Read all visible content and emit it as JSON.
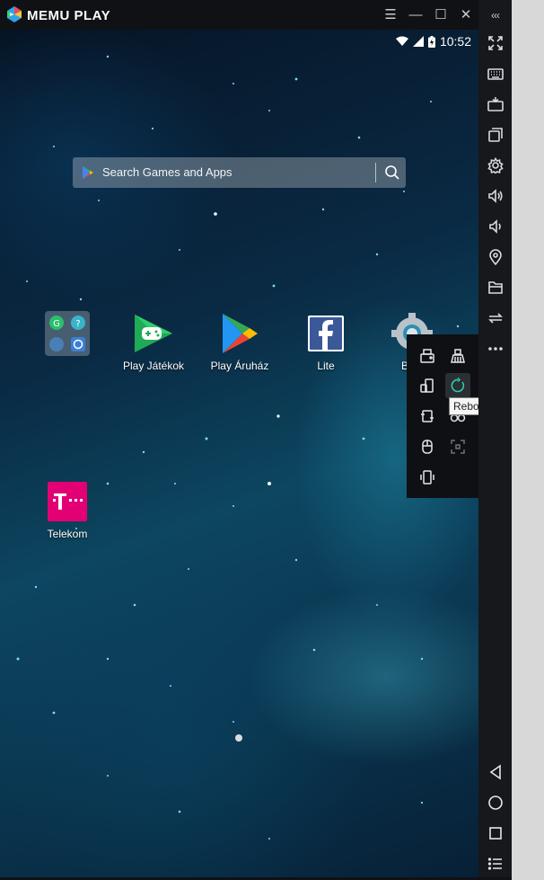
{
  "window": {
    "brand": "MEMU PLAY",
    "menu_icon": "hamburger-icon",
    "minimize_icon": "minimize-icon",
    "maximize_icon": "maximize-icon",
    "close_icon": "close-icon",
    "collapse_label": "‹‹‹"
  },
  "status_bar": {
    "time": "10:52"
  },
  "search": {
    "placeholder": "Search Games and Apps"
  },
  "apps": [
    {
      "label": "",
      "icon": "folder-icon"
    },
    {
      "label": "Play Játékok",
      "icon": "play-games-icon"
    },
    {
      "label": "Play Áruház",
      "icon": "play-store-icon"
    },
    {
      "label": "Lite",
      "icon": "facebook-lite-icon"
    },
    {
      "label": "Beál",
      "icon": "settings-app-icon"
    },
    {
      "label": "Telekom",
      "icon": "telekom-icon"
    }
  ],
  "sidebar_tools": [
    "fullscreen-icon",
    "keyboard-icon",
    "apk-icon",
    "multi-instance-icon",
    "settings-icon",
    "volume-up-icon",
    "volume-down-icon",
    "location-icon",
    "file-icon",
    "sync-icon",
    "more-icon"
  ],
  "tools_panel": [
    "screenshot-icon",
    "cleanup-icon",
    "rotate-icon",
    "reboot-icon",
    "shake-icon",
    "macro-icon",
    "mouse-icon",
    "crosshair-icon",
    "vibrate-icon"
  ],
  "tooltip": "Reboot Android",
  "nav": [
    "back-icon",
    "home-icon",
    "recent-icon",
    "menu-list-icon"
  ],
  "colors": {
    "accent": "#2fd3a6",
    "titlebar": "#0f1114",
    "sidebar": "#16181c"
  }
}
